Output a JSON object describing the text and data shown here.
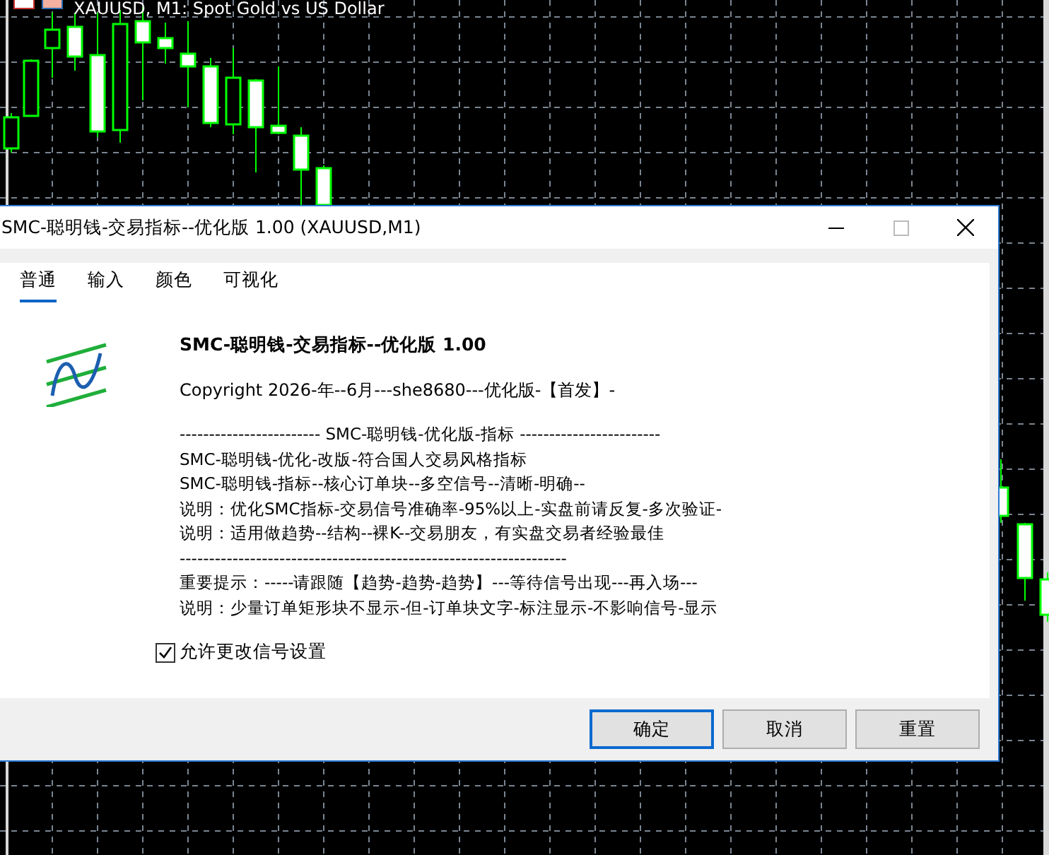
{
  "chart": {
    "title": "XAUUSD, M1: Spot Gold vs US Dollar"
  },
  "dialog": {
    "title": "SMC-聪明钱-交易指标--优化版 1.00 (XAUUSD,M1)",
    "tabs": [
      {
        "label": "普通",
        "selected": true
      },
      {
        "label": "输入",
        "selected": false
      },
      {
        "label": "颜色",
        "selected": false
      },
      {
        "label": "可视化",
        "selected": false
      }
    ],
    "heading": "SMC-聪明钱-交易指标--优化版 1.00",
    "copyright": "Copyright 2026-年--6月---she8680---优化版-【首发】-",
    "lines": [
      "------------------------ SMC-聪明钱-优化版-指标 ------------------------",
      "SMC-聪明钱-优化-改版-符合国人交易风格指标",
      "SMC-聪明钱-指标--核心订单块--多空信号--清晰-明确--",
      "说明：优化SMC指标-交易信号准确率-95%以上-实盘前请反复-多次验证-",
      "说明：适用做趋势--结构--裸K--交易朋友，有实盘交易者经验最佳",
      "------------------------------------------------------------------",
      "重要提示：-----请跟随【趋势-趋势-趋势】---等待信号出现---再入场---",
      "说明：少量订单矩形块不显示-但-订单块文字-标注显示-不影响信号-显示"
    ],
    "checkbox": {
      "label": "允许更改信号设置",
      "checked": true
    },
    "buttons": [
      {
        "label": "确定",
        "default": true
      },
      {
        "label": "取消",
        "default": false
      },
      {
        "label": "重置",
        "default": false
      }
    ]
  }
}
